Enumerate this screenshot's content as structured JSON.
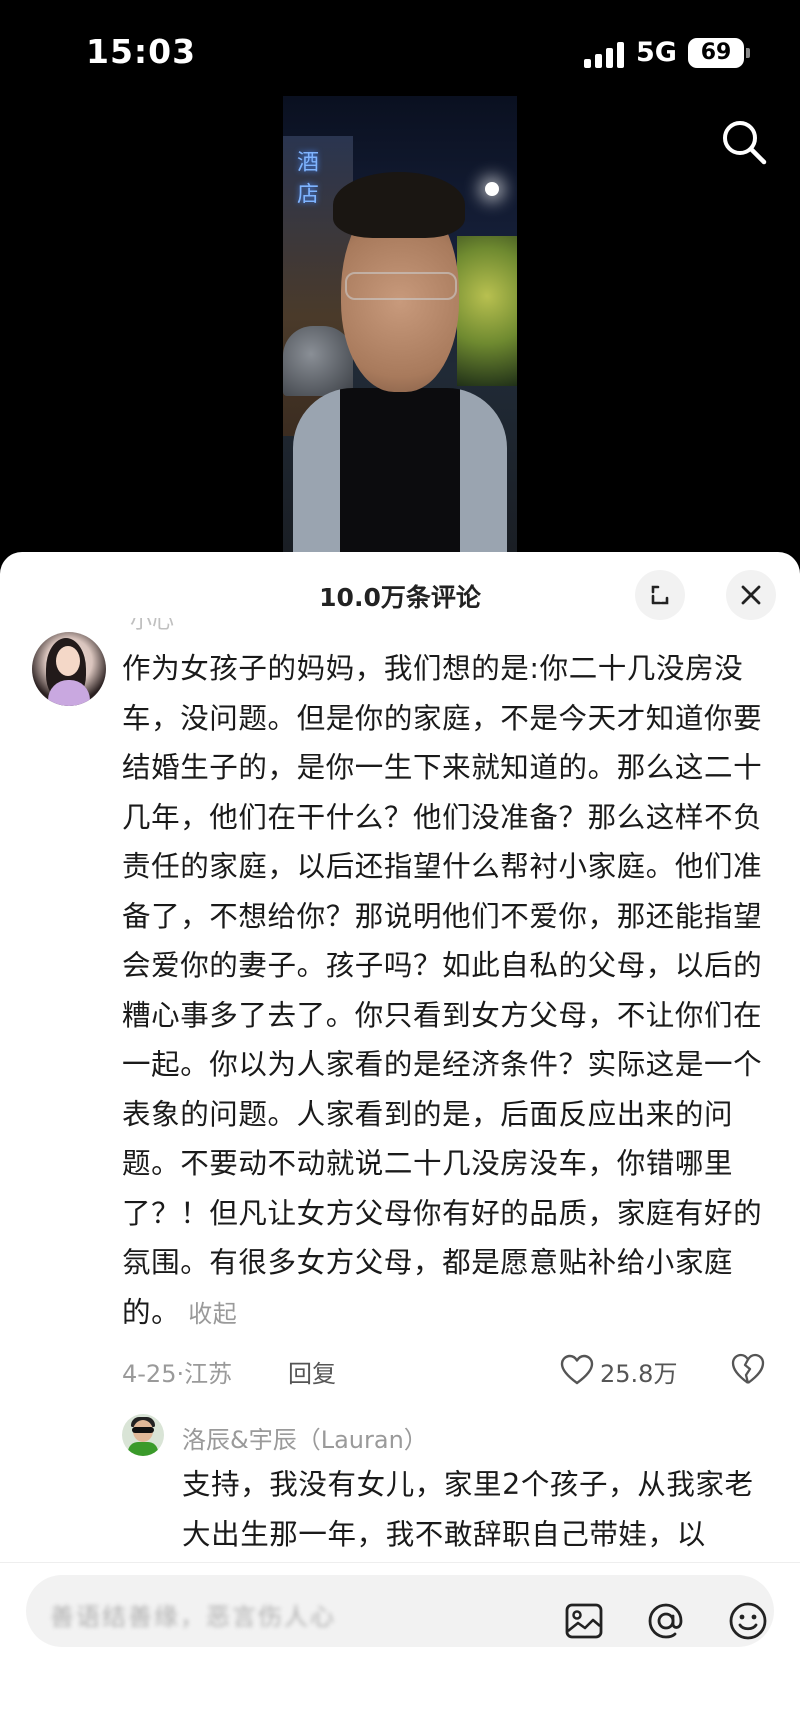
{
  "status_bar": {
    "time": "15:03",
    "network": "5G",
    "battery": "69"
  },
  "video": {
    "sign_text": "酒店"
  },
  "comments_panel": {
    "title": "10.0万条评论"
  },
  "comment": {
    "username_partial": "小心",
    "text": "作为女孩子的妈妈，我们想的是:你二十几没房没车，没问题。但是你的家庭，不是今天才知道你要结婚生子的，是你一生下来就知道的。那么这二十几年，他们在干什么？他们没准备？那么这样不负责任的家庭，以后还指望什么帮衬小家庭。他们准备了，不想给你？那说明他们不爱你，那还能指望会爱你的妻子。孩子吗？如此自私的父母，以后的糟心事多了去了。你只看到女方父母，不让你们在一起。你以为人家看的是经济条件？实际这是一个表象的问题。人家看到的是，后面反应出来的问题。不要动不动就说二十几没房没车，你错哪里了？！但凡让女方父母你有好的品质，家庭有好的氛围。有很多女方父母，都是愿意贴补给小家庭的。",
    "collapse_label": "收起",
    "meta": "4-25·江苏",
    "reply_label": "回复",
    "likes": "25.8万"
  },
  "reply": {
    "username": "洛辰&宇辰（Lauran）",
    "text": "支持，我没有女儿，家里2个孩子，从我家老大出生那一年，我不敢辞职自己带娃，以"
  },
  "input_bar": {
    "placeholder": "善语结善缘，恶言伤人心"
  },
  "icons": {
    "search": "search-icon",
    "expand": "expand-icon",
    "close": "close-icon",
    "like": "heart-icon",
    "dislike": "broken-heart-icon",
    "image": "image-icon",
    "at": "at-icon",
    "emoji": "emoji-icon"
  },
  "colors": {
    "background": "#000000",
    "sheet": "#ffffff",
    "text": "#1a1a1a",
    "muted": "#9a9a9a"
  }
}
